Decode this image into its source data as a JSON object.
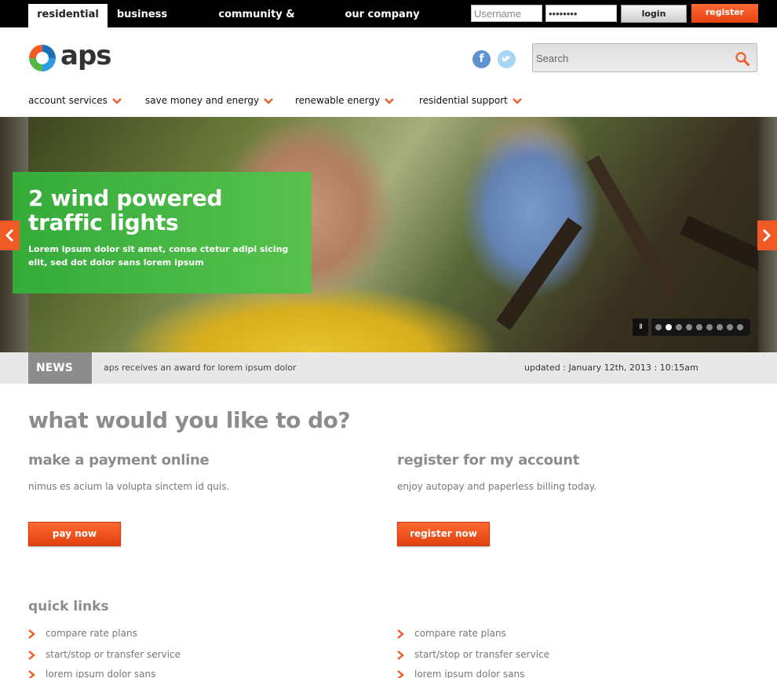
{
  "top_nav": {
    "tabs": [
      "residential",
      "business",
      "community & environment",
      "our company"
    ],
    "active": "residential"
  },
  "login": {
    "username_placeholder": "Username",
    "password_value": "••••••••",
    "login_label": "login",
    "register_label": "register"
  },
  "header": {
    "logo_text": "aps",
    "social": [
      "facebook-icon",
      "twitter-icon"
    ],
    "search_placeholder": "Search"
  },
  "main_nav": [
    "account services",
    "save money and energy",
    "renewable energy",
    "residential support"
  ],
  "hero": {
    "title": "2 wind powered traffic lights",
    "description": "Lorem ipsum dolor sit amet, conse ctetur adipi sicing elit, sed dot dolor sans lorem ipsum",
    "slide_count": 9,
    "active_slide": 2,
    "pause_label": "II"
  },
  "news": {
    "label": "NEWS",
    "headline": "aps receives an award for lorem ipsum dolor",
    "updated": "updated : January 12th, 2013 : 10:15am"
  },
  "main": {
    "heading": "what would you like to do?",
    "payment": {
      "heading": "make a payment online",
      "text": "nimus es acium la volupta sinctem id quis.",
      "button": "pay now"
    },
    "register": {
      "heading": "register for my account",
      "text": "enjoy autopay and paperless billing today.",
      "button": "register now"
    }
  },
  "quick_links": {
    "heading": "quick links",
    "left": [
      "compare rate plans",
      "start/stop or transfer service",
      "lorem ipsum dolor sans"
    ],
    "right": [
      "compare rate plans",
      "start/stop or transfer service",
      "lorem ipsum dolor sans"
    ]
  },
  "colors": {
    "accent": "#f15a24",
    "hero_card": "#4cb748",
    "heading_gray": "#8c8c8c"
  }
}
